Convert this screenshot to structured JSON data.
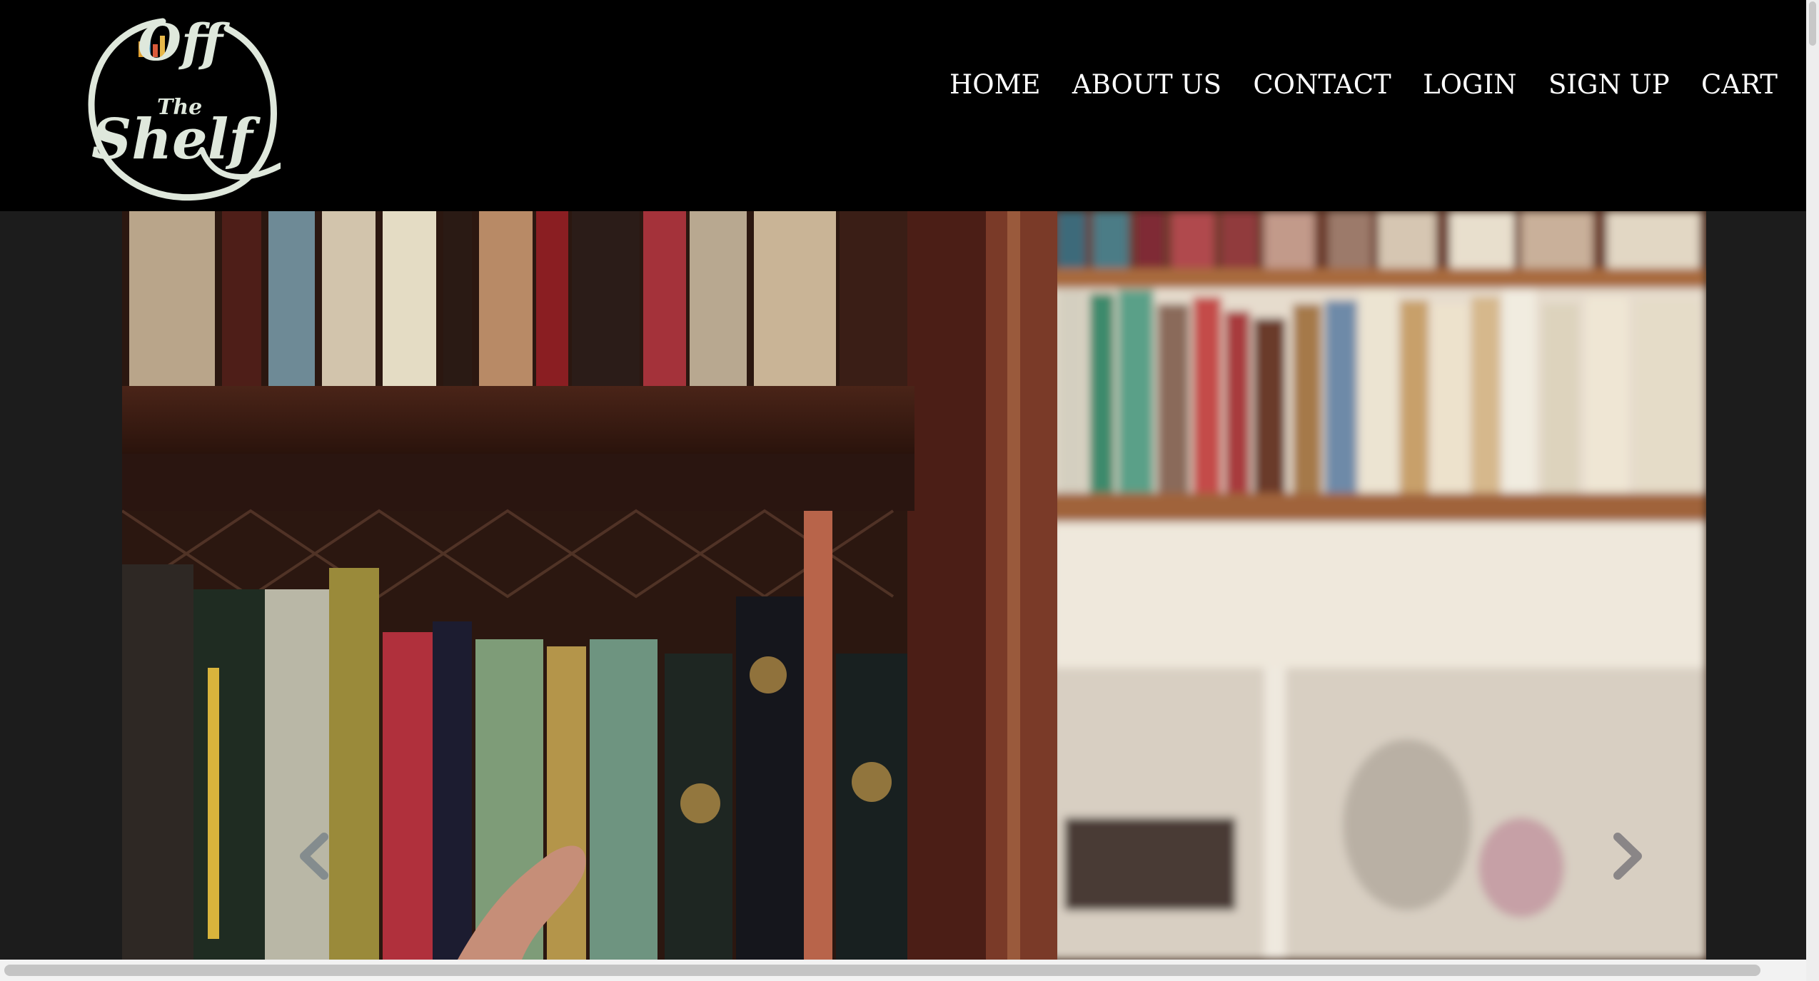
{
  "brand": {
    "logo_line1": "Off",
    "logo_line2": "The",
    "logo_line3": "Shelf"
  },
  "nav": {
    "items": [
      {
        "label": "HOME"
      },
      {
        "label": "ABOUT US"
      },
      {
        "label": "CONTACT"
      },
      {
        "label": "LOGIN"
      },
      {
        "label": "SIGN UP"
      },
      {
        "label": "CART"
      }
    ]
  },
  "carousel": {
    "prev_icon": "chevron-left-icon",
    "next_icon": "chevron-right-icon"
  },
  "colors": {
    "header_bg": "#000000",
    "page_bg": "#1c1c1c",
    "nav_text": "#ffffff",
    "logo": "#dfe8dc"
  }
}
